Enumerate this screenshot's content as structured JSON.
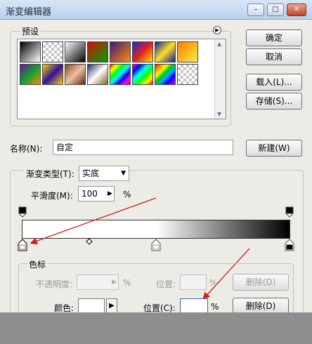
{
  "window": {
    "title": "渐变编辑器",
    "min_label": "–",
    "max_label": "□",
    "close_label": "✕"
  },
  "presets": {
    "label": "预设",
    "swatches": [
      {
        "name": "black-white",
        "bg": "linear-gradient(135deg,#000,#fff)"
      },
      {
        "name": "transparent",
        "bg": "checker"
      },
      {
        "name": "black-white-2",
        "bg": "linear-gradient(135deg,#fff,#000)"
      },
      {
        "name": "red-green",
        "bg": "linear-gradient(135deg,#d01010,#00a000)"
      },
      {
        "name": "violet-orange",
        "bg": "linear-gradient(135deg,#3a1a80,#ff8c00)"
      },
      {
        "name": "blue-red-yellow",
        "bg": "linear-gradient(135deg,#1030c0,#e02020,#ffe000)"
      },
      {
        "name": "blue-yellow-blue",
        "bg": "linear-gradient(135deg,#1020a0,#ffe020,#1020a0)"
      },
      {
        "name": "orange-yellow",
        "bg": "linear-gradient(135deg,#ff7a00,#ffee40)"
      },
      {
        "name": "violet-green-orange",
        "bg": "linear-gradient(135deg,#7010a0,#10a030,#ff8800)"
      },
      {
        "name": "yellow-violet",
        "bg": "linear-gradient(135deg,#ffd000,#3010a0,#ffd000)"
      },
      {
        "name": "copper",
        "bg": "linear-gradient(135deg,#8a4a20,#f0c0a0,#5a2a10)"
      },
      {
        "name": "chrome",
        "bg": "linear-gradient(135deg,#203060,#fff,#806020)"
      },
      {
        "name": "spectrum-1",
        "bg": "linear-gradient(135deg,#f00,#ff0,#0f0,#0ff,#00f,#f0f,#f00)"
      },
      {
        "name": "spectrum-2",
        "bg": "linear-gradient(135deg,#f0f,#00f,#0ff,#0f0,#ff0,#f00)"
      },
      {
        "name": "rainbow-stripes",
        "bg": "linear-gradient(135deg,#f00 0%,#f80 15%,#ff0 30%,#0c0 45%,#0af 60%,#00f 75%,#80f 90%)"
      },
      {
        "name": "transparent-stripes",
        "bg": "checker"
      }
    ]
  },
  "buttons": {
    "ok": "确定",
    "cancel": "取消",
    "load": "载入(L)...",
    "save": "存储(S)...",
    "new": "新建(W)",
    "delete_1": "删除(D)",
    "delete_2": "删除(D)"
  },
  "name_field": {
    "label": "名称(N):",
    "value": "自定"
  },
  "gradient_type": {
    "label": "渐变类型(T):",
    "value": "实底"
  },
  "smoothness": {
    "label": "平滑度(M):",
    "value": "100",
    "unit": "%"
  },
  "color_stops": {
    "label": "色标",
    "opacity_label": "不透明度:",
    "opacity_unit": "%",
    "location_label_1": "位置:",
    "location_unit_1": "%",
    "color_label": "颜色:",
    "location_label_2": "位置(C):",
    "location_unit_2": "%"
  },
  "colors": {
    "accent_arrow": "#c8211e",
    "dialog_bg": "#ecebe6"
  }
}
